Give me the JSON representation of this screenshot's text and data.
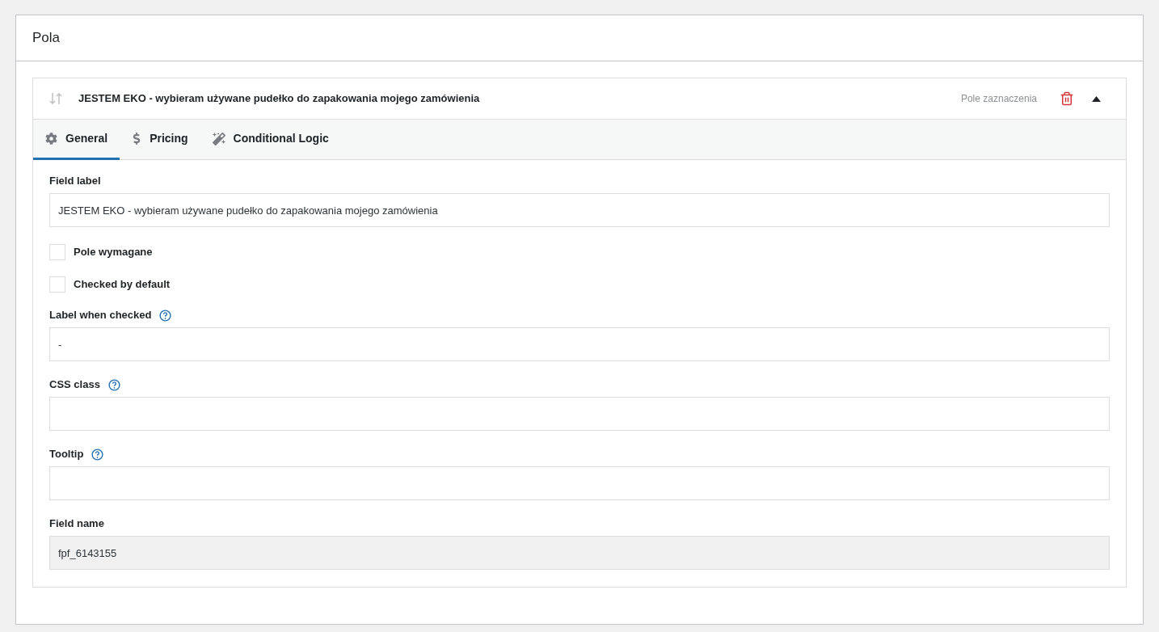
{
  "panel": {
    "title": "Pola"
  },
  "field_card": {
    "title": "JESTEM EKO - wybieram używane pudełko do zapakowania mojego zamówienia",
    "type": "Pole zaznaczenia",
    "expanded": true
  },
  "tabs": [
    {
      "label": "General",
      "selected": true
    },
    {
      "label": "Pricing",
      "selected": false
    },
    {
      "label": "Conditional Logic",
      "selected": false
    }
  ],
  "fields": [
    {
      "kind": "text",
      "label": "Field label",
      "help": false,
      "value": "JESTEM EKO - wybieram używane pudełko do zapakowania mojego zamówienia"
    },
    {
      "kind": "checkbox",
      "label": "Pole wymagane",
      "checked": false
    },
    {
      "kind": "checkbox",
      "label": "Checked by default",
      "checked": false
    },
    {
      "kind": "text",
      "label": "Label when checked",
      "help": true,
      "value": "-"
    },
    {
      "kind": "text",
      "label": "CSS class",
      "help": true
    },
    {
      "kind": "text",
      "label": "Tooltip",
      "help": true
    },
    {
      "kind": "readonly",
      "label": "Field name",
      "help": false,
      "value": "fpf_6143155"
    }
  ]
}
